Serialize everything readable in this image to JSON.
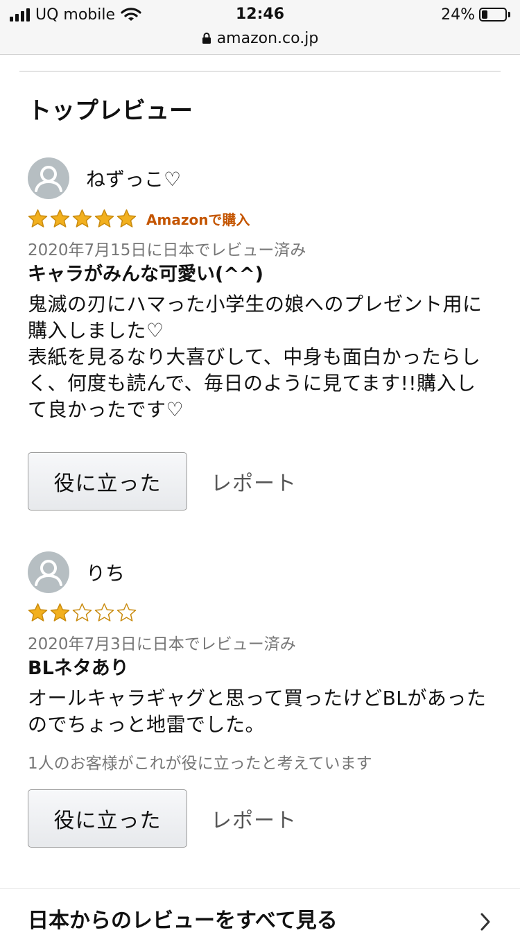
{
  "status_bar": {
    "carrier": "UQ mobile",
    "time": "12:46",
    "battery_percent": "24%",
    "battery_level": 0.24,
    "url": "amazon.co.jp",
    "icons": [
      "signal-icon",
      "wifi-icon",
      "battery-icon",
      "lock-icon"
    ]
  },
  "section": {
    "title": "トップレビュー"
  },
  "reviews": [
    {
      "name": "ねずっこ♡",
      "rating": 5,
      "max_rating": 5,
      "verified": "Amazonで購入",
      "date": "2020年7月15日に日本でレビュー済み",
      "title": "キャラがみんな可愛い(^^)",
      "body": "鬼滅の刃にハマった小学生の娘へのプレゼント用に購入しました♡\n表紙を見るなり大喜びして、中身も面白かったらしく、何度も読んで、毎日のように見てます!!購入して良かったです♡",
      "helpful_text": "",
      "helpful_label": "役に立った",
      "report_label": "レポート"
    },
    {
      "name": "りち",
      "rating": 2,
      "max_rating": 5,
      "verified": "",
      "date": "2020年7月3日に日本でレビュー済み",
      "title": "BLネタあり",
      "body": "オールキャラギャグと思って買ったけどBLがあったのでちょっと地雷でした。",
      "helpful_text": "1人のお客様がこれが役に立ったと考えています",
      "helpful_label": "役に立った",
      "report_label": "レポート"
    }
  ],
  "footer": {
    "see_all": "日本からのレビューをすべて見る"
  },
  "colors": {
    "star": "#f2b01e",
    "star_outline": "#c98b0f",
    "verified": "#c45500",
    "muted": "#767676"
  }
}
